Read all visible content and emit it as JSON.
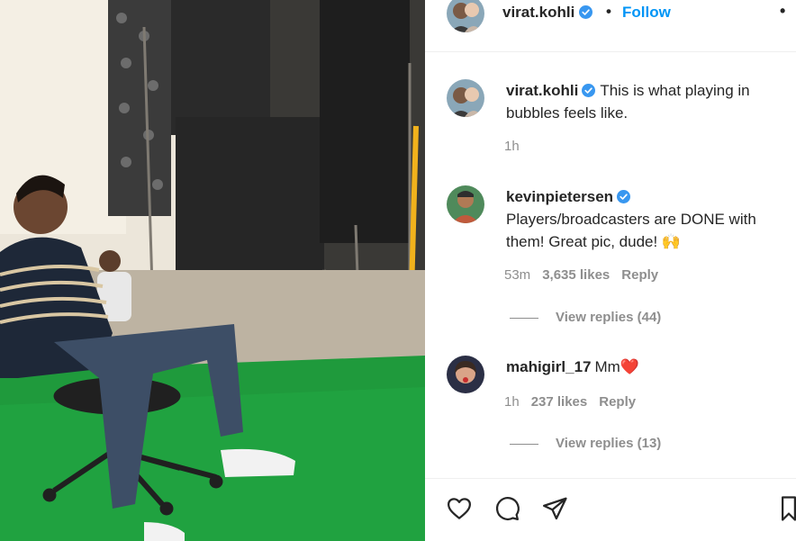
{
  "post": {
    "author": "virat.kohli",
    "separator": "•",
    "follow_label": "Follow",
    "more_label": "•",
    "caption": {
      "username": "virat.kohli",
      "text": "This is what playing in bubbles feels like.",
      "time": "1h"
    }
  },
  "comments": [
    {
      "username": "kevinpietersen",
      "text": "Players/broadcasters are DONE with them! Great pic, dude! 🙌",
      "time": "53m",
      "likes": "3,635 likes",
      "reply_label": "Reply",
      "view_replies": "View replies (44)"
    },
    {
      "username": "mahigirl_17",
      "text": "Mm❤️",
      "time": "1h",
      "likes": "237 likes",
      "reply_label": "Reply",
      "view_replies": "View replies (13)"
    }
  ],
  "icons": {
    "like": "heart-icon",
    "comment": "comment-icon",
    "share": "share-icon",
    "save": "bookmark-icon",
    "verified": "verified-badge-icon"
  },
  "colors": {
    "link": "#0095f6",
    "verified": "#3897f0",
    "secondary_text": "#8e8e8e",
    "primary_text": "#262626",
    "heart_red": "#e0245e"
  }
}
